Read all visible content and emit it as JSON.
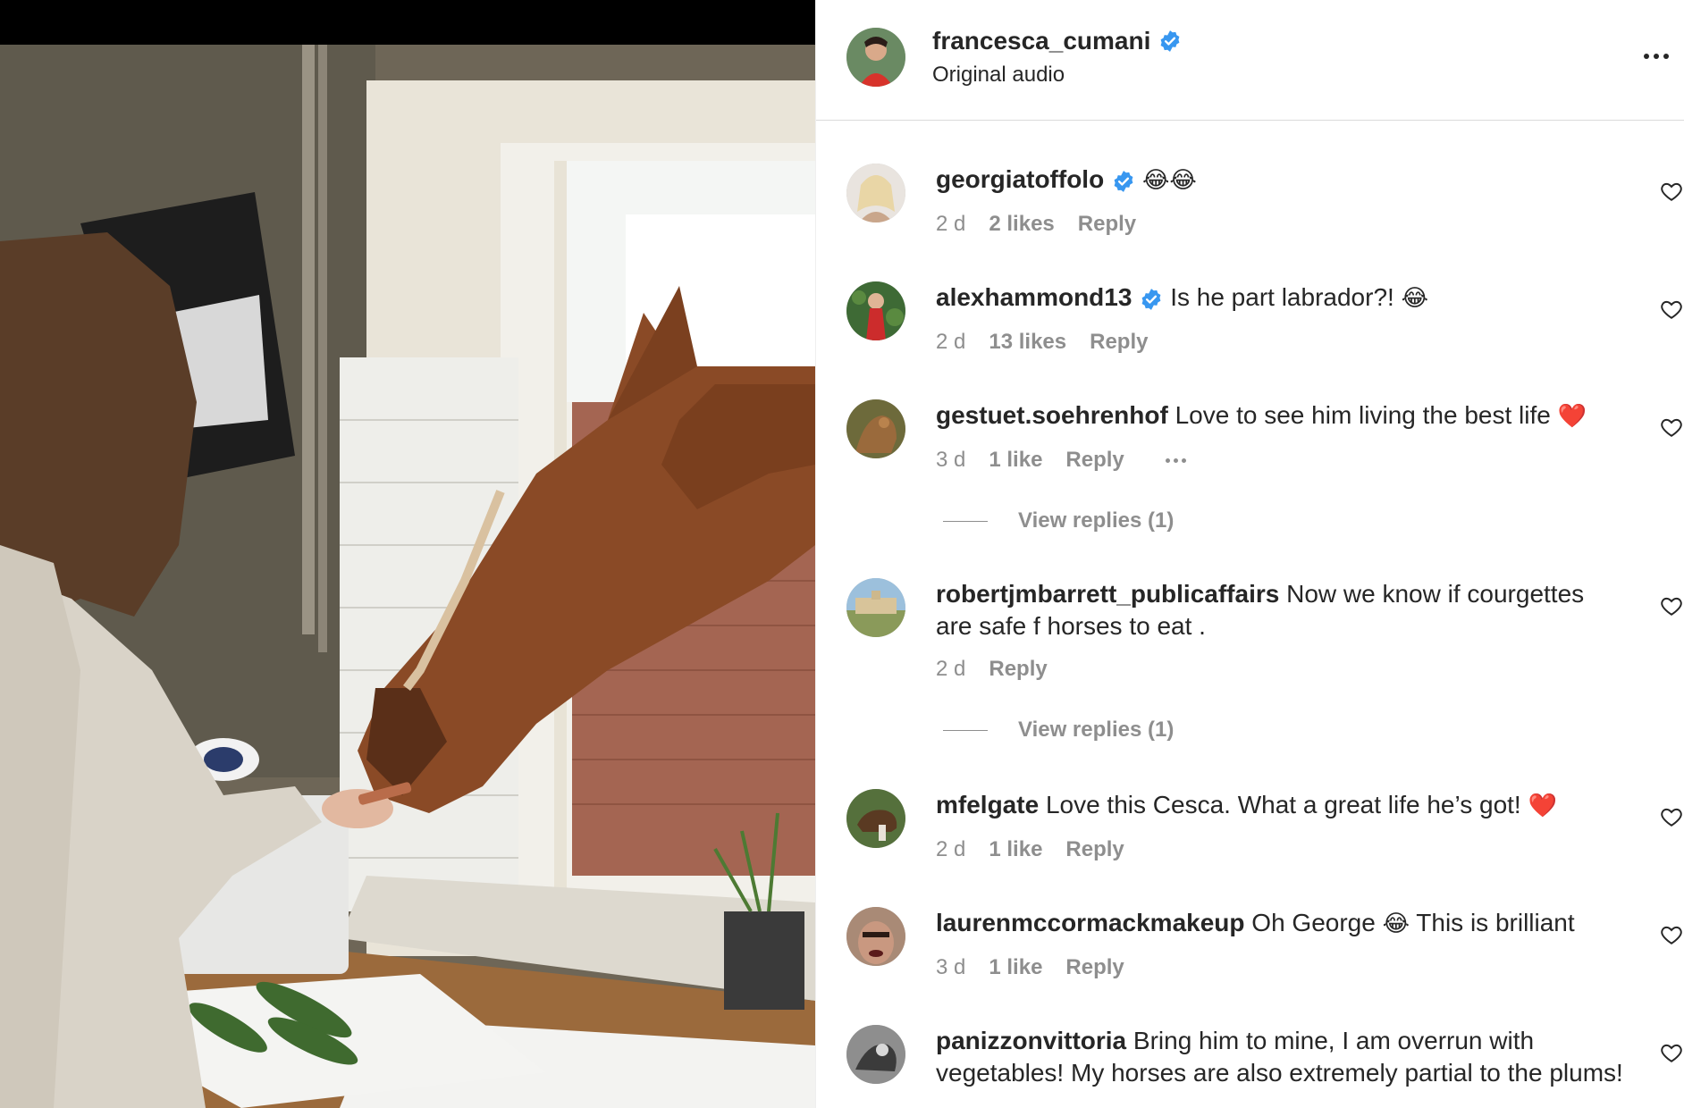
{
  "post": {
    "username": "francesca_cumani",
    "verified": true,
    "subtitle": "Original audio",
    "more_icon": "more-horizontal-icon"
  },
  "media": {
    "description_icon": "video-frame"
  },
  "comments": [
    {
      "username": "georgiatoffolo",
      "verified": true,
      "text": "",
      "emoji": "😂😂",
      "time": "2 d",
      "likes": "2 likes",
      "reply": "Reply",
      "view_replies": ""
    },
    {
      "username": "alexhammond13",
      "verified": true,
      "text": "Is he part labrador?!",
      "emoji": "😂",
      "time": "2 d",
      "likes": "13 likes",
      "reply": "Reply",
      "view_replies": ""
    },
    {
      "username": "gestuet.soehrenhof",
      "verified": false,
      "text": "Love to see him living the best life",
      "emoji": "❤️",
      "time": "3 d",
      "likes": "1 like",
      "reply": "Reply",
      "view_replies": "View replies (1)"
    },
    {
      "username": "robertjmbarrett_publicaffairs",
      "verified": false,
      "text": "Now we know if courgettes are safe f horses to eat .",
      "emoji": "",
      "time": "2 d",
      "likes": "",
      "reply": "Reply",
      "view_replies": "View replies (1)"
    },
    {
      "username": "mfelgate",
      "verified": false,
      "text": "Love this Cesca. What a great life he’s got!",
      "emoji": "❤️",
      "time": "2 d",
      "likes": "1 like",
      "reply": "Reply",
      "view_replies": ""
    },
    {
      "username": "laurenmccormackmakeup",
      "verified": false,
      "text": "Oh George",
      "emoji": "😂",
      "text_after": "This is brilliant",
      "time": "3 d",
      "likes": "1 like",
      "reply": "Reply",
      "view_replies": ""
    },
    {
      "username": "panizzonvittoria",
      "verified": false,
      "text": "Bring him to mine, I am overrun with vegetables! My horses are also extremely partial to the plums!",
      "emoji": "",
      "time": "",
      "likes": "",
      "reply": "",
      "view_replies": ""
    }
  ],
  "colors": {
    "verified": "#3897f0",
    "text_primary": "#262626",
    "text_secondary": "#8e8e8e",
    "heart_red": "#ed4956"
  }
}
